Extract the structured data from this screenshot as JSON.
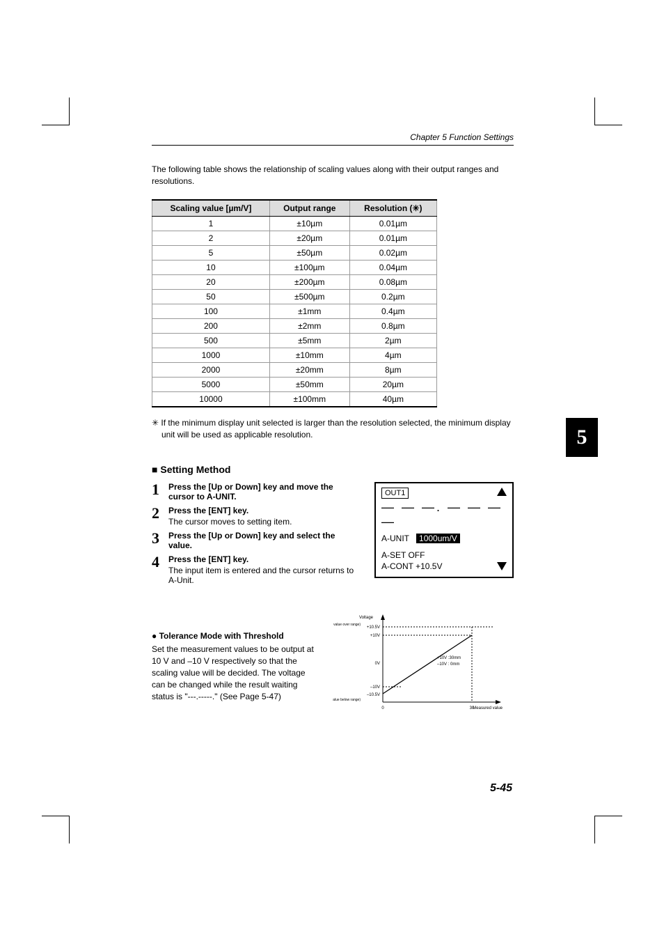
{
  "chapter_header": "Chapter 5  Function Settings",
  "intro": "The following table shows the relationship of scaling values along with their output ranges and resolutions.",
  "table": {
    "headers": {
      "c1": "Scaling value [µm/V]",
      "c2": "Output range",
      "c3": "Resolution (✳)"
    },
    "rows": [
      {
        "c1": "1",
        "c2": "±10µm",
        "c3": "0.01µm"
      },
      {
        "c1": "2",
        "c2": "±20µm",
        "c3": "0.01µm"
      },
      {
        "c1": "5",
        "c2": "±50µm",
        "c3": "0.02µm"
      },
      {
        "c1": "10",
        "c2": "±100µm",
        "c3": "0.04µm"
      },
      {
        "c1": "20",
        "c2": "±200µm",
        "c3": "0.08µm"
      },
      {
        "c1": "50",
        "c2": "±500µm",
        "c3": "0.2µm"
      },
      {
        "c1": "100",
        "c2": "±1mm",
        "c3": "0.4µm"
      },
      {
        "c1": "200",
        "c2": "±2mm",
        "c3": "0.8µm"
      },
      {
        "c1": "500",
        "c2": "±5mm",
        "c3": "2µm"
      },
      {
        "c1": "1000",
        "c2": "±10mm",
        "c3": "4µm"
      },
      {
        "c1": "2000",
        "c2": "±20mm",
        "c3": "8µm"
      },
      {
        "c1": "5000",
        "c2": "±50mm",
        "c3": "20µm"
      },
      {
        "c1": "10000",
        "c2": "±100mm",
        "c3": "40µm"
      }
    ]
  },
  "footnote": "✳ If the minimum display unit selected is larger than the resolution selected, the minimum display unit will be used as applicable resolution.",
  "section_heading": "Setting Method",
  "steps": {
    "s1": {
      "num": "1",
      "title": "Press the [Up or Down] key and move the cursor to A-UNIT."
    },
    "s2": {
      "num": "2",
      "title": "Press the [ENT] key.",
      "desc": "The cursor moves to setting item."
    },
    "s3": {
      "num": "3",
      "title": "Press the [Up or Down] key and select the value."
    },
    "s4": {
      "num": "4",
      "title": "Press the [ENT] key.",
      "desc": "The input item is entered and the cursor returns to A-Unit."
    }
  },
  "lcd": {
    "out": "OUT1",
    "dashes": "— — —.  — — — —",
    "row1_label": "A-UNIT",
    "row1_value": "1000um/V",
    "row2": "A-SET     OFF",
    "row3": "A-CONT +10.5V"
  },
  "tolerance": {
    "heading": "Tolerance Mode with Threshold",
    "body": "Set the measurement values to be output at 10 V and –10 V respectively so that the scaling value will be decided. The voltage can be changed while the result waiting status is  \"---.-----.\" (See Page 5-47)"
  },
  "diagram_labels": {
    "voltage": "Voltage",
    "pos_over": "(Positive value over range)",
    "p105": "+10.5V",
    "p10": "+10V",
    "zero": "0V",
    "m10": "–10V",
    "m105": "–10.5V",
    "neg_below": "(Negative value below range)",
    "legend1": "+10V :30mm",
    "legend2": "–10V :  0mm",
    "x0": "0",
    "x30": "30",
    "xaxis": "Measured value"
  },
  "side_tab": "5",
  "page_number": "5-45"
}
